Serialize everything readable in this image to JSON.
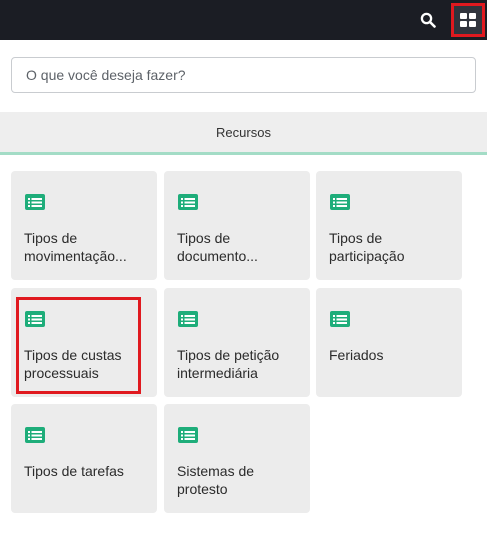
{
  "header": {
    "search_icon": "search-icon",
    "apps_icon": "grid-apps-icon",
    "bg_color": "#1b1d24",
    "highlight_color": "#e0191f"
  },
  "search": {
    "placeholder": "O que você deseja fazer?"
  },
  "tab": {
    "label": "Recursos",
    "underline_color": "#a3dcc6"
  },
  "cards": [
    {
      "line1": "Tipos de",
      "line2": "movimentação...",
      "icon": "list-icon"
    },
    {
      "line1": "Tipos de",
      "line2": "documento...",
      "icon": "list-icon"
    },
    {
      "line1": "Tipos de",
      "line2": "participação",
      "icon": "list-icon"
    },
    {
      "line1": "Tipos de custas",
      "line2": "processuais",
      "icon": "list-icon",
      "highlighted": true
    },
    {
      "line1": "Tipos de petição",
      "line2": "intermediária",
      "icon": "list-icon"
    },
    {
      "line1": "Feriados",
      "line2": "",
      "icon": "list-icon"
    },
    {
      "line1": "Tipos de tarefas",
      "line2": "",
      "icon": "list-icon"
    },
    {
      "line1": "Sistemas de",
      "line2": "protesto",
      "icon": "list-icon"
    }
  ],
  "icon_color": "#1ead7a"
}
